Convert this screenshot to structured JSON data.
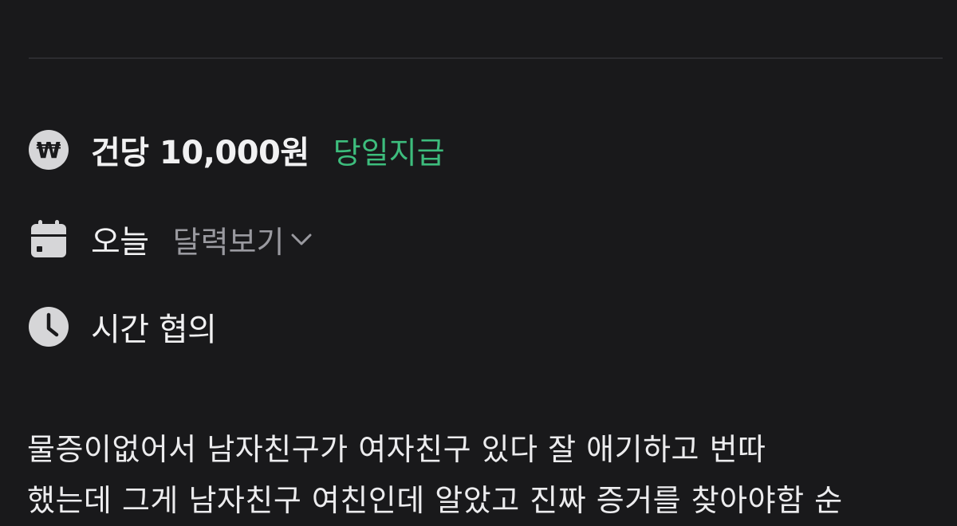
{
  "pay": {
    "amount_label": "건당 10,000원",
    "badge": "당일지급",
    "icon": "won-coin-icon",
    "badge_color": "#3dbd7d"
  },
  "date": {
    "label": "오늘",
    "calendar_link": "달력보기",
    "icon": "calendar-icon"
  },
  "time": {
    "label": "시간 협의",
    "icon": "clock-icon"
  },
  "description": {
    "line1": "물증이없어서 남자친구가 여자친구 있다 잘 애기하고 번따",
    "line2": "했는데 그게 남자친구 여친인데 알았고 진짜 증거를 찾아야함 순"
  },
  "colors": {
    "background": "#19191b",
    "text_primary": "#f1f1f2",
    "text_secondary": "#9a9aa0",
    "accent_green": "#3dbd7d"
  }
}
